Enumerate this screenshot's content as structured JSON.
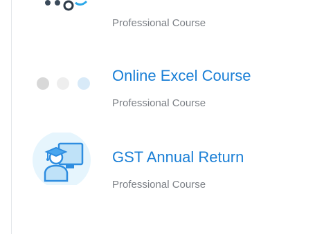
{
  "courses": [
    {
      "title": "",
      "subtitle": "Professional Course",
      "icon": "course-logo-icon"
    },
    {
      "title": "Online Excel Course",
      "subtitle": "Professional Course",
      "icon": "loading-dots-icon"
    },
    {
      "title": "GST Annual Return",
      "subtitle": "Professional Course",
      "icon": "graduate-computer-icon"
    }
  ],
  "colors": {
    "link": "#1a7fd6",
    "muted": "#7b7f85",
    "icon_blue": "#4aa6ee",
    "icon_bg": "#e6f5fd"
  }
}
